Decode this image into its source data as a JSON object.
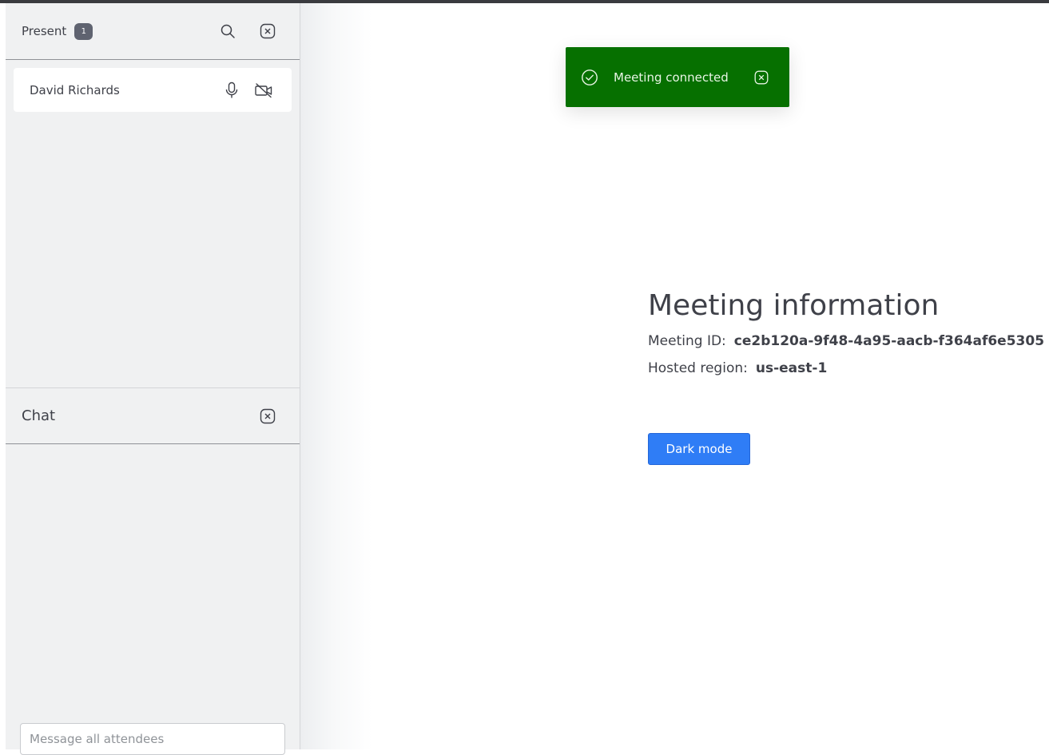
{
  "roster": {
    "title": "Present",
    "count": "1",
    "icons": {
      "search": "search-icon",
      "close": "close-icon"
    },
    "attendees": [
      {
        "name": "David Richards",
        "mic_icon": "microphone-icon",
        "video_icon": "camera-off-icon"
      }
    ]
  },
  "chat": {
    "title": "Chat",
    "close_icon": "close-icon",
    "input_placeholder": "Message all attendees"
  },
  "toast": {
    "message": "Meeting connected",
    "status_icon": "check-circle-icon",
    "close_icon": "close-icon",
    "color": "#067000"
  },
  "meeting": {
    "title": "Meeting information",
    "id_label": "Meeting ID:",
    "id_value": "ce2b120a-9f48-4a95-aacb-f364af6e5305",
    "region_label": "Hosted region:",
    "region_value": "us-east-1",
    "dark_mode_label": "Dark mode"
  },
  "colors": {
    "accent": "#2f7df6",
    "panel_bg": "#f0f1f2",
    "badge_bg": "#5f6370"
  }
}
